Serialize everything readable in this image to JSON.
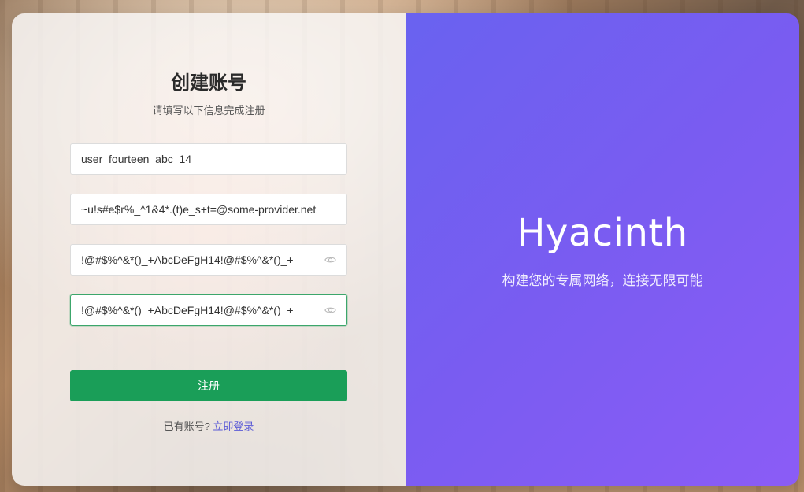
{
  "register": {
    "title": "创建账号",
    "subtitle": "请填写以下信息完成注册",
    "username_value": "user_fourteen_abc_14",
    "email_value": "~u!s#e$r%_^1&4*.(t)e_s+t=@some-provider.net",
    "password_value": "!@#$%^&*()_+AbcDeFgH14!@#$%^&*()_+",
    "confirm_password_value": "!@#$%^&*()_+AbcDeFgH14!@#$%^&*()_+",
    "password_icon": "eye-icon",
    "confirm_icon": "eye-icon",
    "submit_label": "注册",
    "have_account_text": "已有账号?",
    "login_link": "立即登录"
  },
  "brand": {
    "name": "Hyacinth",
    "tagline": "构建您的专属网络，连接无限可能"
  },
  "colors": {
    "accent_green": "#1a9e58",
    "link_blue": "#5b5bd6",
    "panel_gradient_start": "#6962f0",
    "panel_gradient_end": "#8b5cf6"
  }
}
